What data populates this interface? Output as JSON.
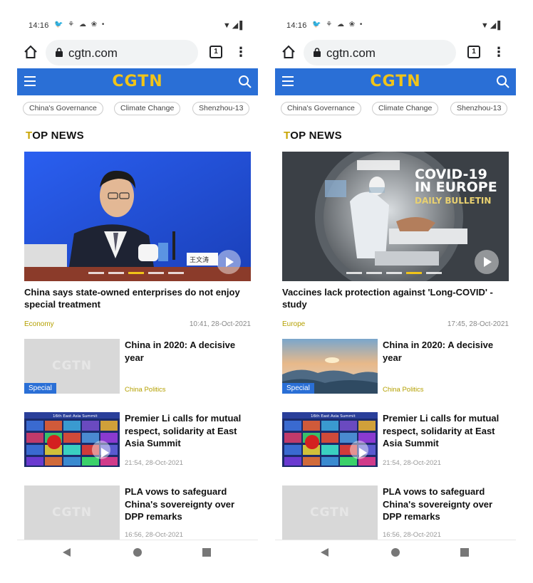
{
  "screens": [
    {
      "status": {
        "time": "14:16",
        "notif_icons": "🐦 ⚘ ☁ ❀ •",
        "sys_icons": "▼◢▌"
      },
      "browser": {
        "url": "cgtn.com",
        "tab_count": "1",
        "menu_glyph": "⋮"
      },
      "site": {
        "logo": "CGTN"
      },
      "chips": [
        "China's Governance",
        "Climate Change",
        "Shenzhou-13"
      ],
      "section": {
        "first_letter": "T",
        "rest": "OP NEWS"
      },
      "hero": {
        "title": "China says state-owned enterprises do not enjoy special treatment",
        "category": "Economy",
        "time": "10:41, 28-Oct-2021",
        "image": "press-conference-speaker",
        "nameplate": "王文涛"
      },
      "items": [
        {
          "title": "China in 2020: A decisive year",
          "category": "China Politics",
          "badge": "Special",
          "watermark": "CGTN",
          "image": "placeholder"
        },
        {
          "title": "Premier Li calls for mutual respect, solidarity at East Asia Summit",
          "time": "21:54, 28-Oct-2021",
          "image": "video-conference-grid",
          "banner": "16th East Asia Summit"
        },
        {
          "title": "PLA vows to safeguard China's sovereignty over DPP remarks",
          "time": "16:56, 28-Oct-2021",
          "watermark": "CGTN",
          "image": "placeholder"
        }
      ],
      "nav": {
        "back": "back-icon",
        "home": "home-icon",
        "recents": "recents-icon"
      }
    },
    {
      "status": {
        "time": "14:16",
        "notif_icons": "🐦 ⚘ ☁ ❀ •",
        "sys_icons": "▼◢▌"
      },
      "browser": {
        "url": "cgtn.com",
        "tab_count": "1",
        "menu_glyph": "⋮"
      },
      "site": {
        "logo": "CGTN"
      },
      "chips": [
        "China's Governance",
        "Climate Change",
        "Shenzhou-13"
      ],
      "section": {
        "first_letter": "T",
        "rest": "OP NEWS"
      },
      "hero": {
        "title": "Vaccines lack protection against 'Long-COVID' - study",
        "category": "Europe",
        "time": "17:45, 28-Oct-2021",
        "image": "ct-scanner-medical",
        "overlay_line1": "COVID-19",
        "overlay_line2": "IN EUROPE",
        "overlay_line3": "DAILY BULLETIN"
      },
      "items": [
        {
          "title": "China in 2020: A decisive year",
          "category": "China Politics",
          "badge": "Special",
          "image": "mountain-landscape"
        },
        {
          "title": "Premier Li calls for mutual respect, solidarity at East Asia Summit",
          "time": "21:54, 28-Oct-2021",
          "image": "video-conference-grid",
          "banner": "16th East Asia Summit"
        },
        {
          "title": "PLA vows to safeguard China's sovereignty over DPP remarks",
          "time": "16:56, 28-Oct-2021",
          "watermark": "CGTN",
          "image": "placeholder"
        }
      ],
      "nav": {
        "back": "back-icon",
        "home": "home-icon",
        "recents": "recents-icon"
      }
    }
  ],
  "colors": {
    "brand_blue": "#2a6fd6",
    "logo_gold": "#f0c419",
    "category_olive": "#b4a000",
    "badge_blue": "#2a6fd6"
  }
}
